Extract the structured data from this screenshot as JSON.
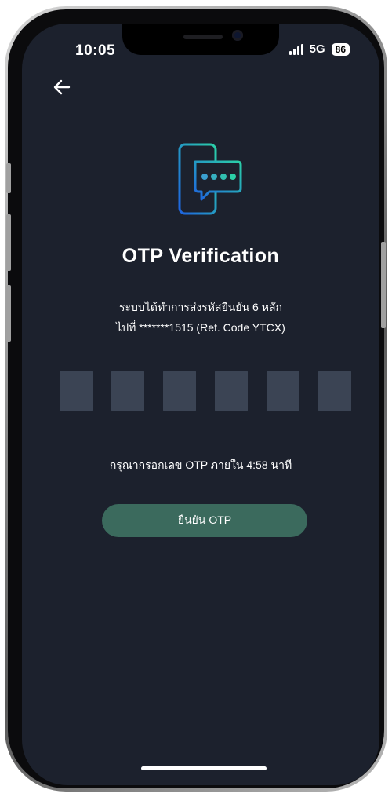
{
  "status_bar": {
    "time": "10:05",
    "network": "5G",
    "battery": "86"
  },
  "header": {
    "back_icon": "arrow-left-icon"
  },
  "hero": {
    "icon": "phone-otp-message-icon",
    "title": "OTP Verification"
  },
  "description": {
    "line1": "ระบบได้ทำการส่งรหัสยืนยัน 6 หลัก",
    "line2": "ไปที่ *******1515 (Ref. Code YTCX)"
  },
  "otp_inputs": [
    "",
    "",
    "",
    "",
    "",
    ""
  ],
  "timer": {
    "text": "กรุณากรอกเลข OTP ภายใน  4:58 นาที"
  },
  "confirm_button": {
    "label": "ยืนยัน OTP"
  },
  "colors": {
    "background": "#1c212d",
    "otp_box": "#3b4454",
    "button": "#3b6a5d",
    "icon_gradient_start": "#1e88e5",
    "icon_gradient_end": "#26c6a0"
  }
}
